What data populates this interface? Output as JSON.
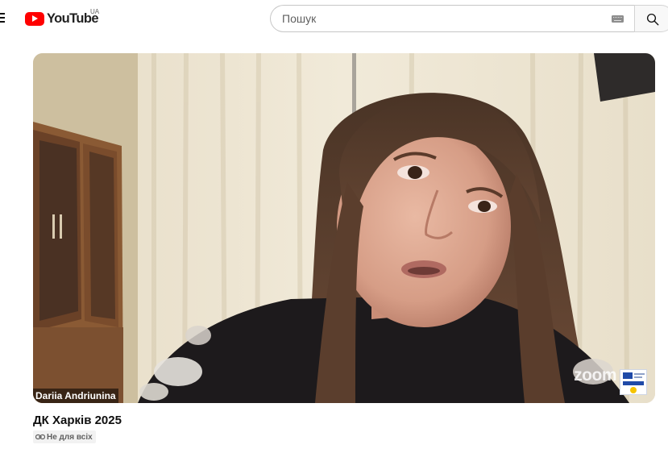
{
  "header": {
    "logo_text": "YouTube",
    "region_code": "UA",
    "search_placeholder": "Пошук"
  },
  "icons": {
    "menu": "hamburger-menu-icon",
    "keyboard": "keyboard-icon",
    "search": "search-icon",
    "badge": "link-icon"
  },
  "player": {
    "participant_name": "Dariia Andriunina",
    "zoom_watermark": "zoom"
  },
  "video": {
    "title": "ДК Харків 2025",
    "visibility_label": "Не для всіх"
  },
  "colors": {
    "brand_red": "#ff0000",
    "text_primary": "#0f0f0f",
    "text_secondary": "#606060"
  }
}
